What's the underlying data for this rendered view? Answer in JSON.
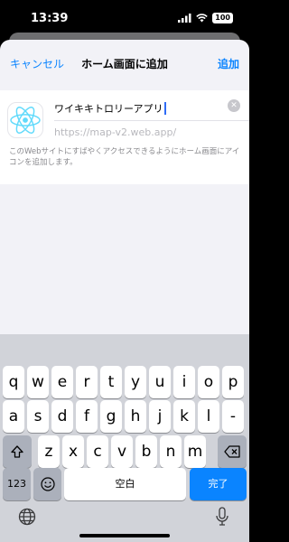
{
  "status": {
    "time": "13:39",
    "battery": "100"
  },
  "nav": {
    "cancel_label": "キャンセル",
    "title": "ホーム画面に追加",
    "add_label": "追加"
  },
  "form": {
    "name_value": "ワイキキトロリーアプリ",
    "url_value": "https://map-v2.web.app/",
    "hint_text": "このWebサイトにすばやくアクセスできるようにホーム画面にアイコンを追加します。"
  },
  "keyboard": {
    "row1": [
      "q",
      "w",
      "e",
      "r",
      "t",
      "y",
      "u",
      "i",
      "o",
      "p"
    ],
    "row2": [
      "a",
      "s",
      "d",
      "f",
      "g",
      "h",
      "j",
      "k",
      "l",
      "-"
    ],
    "row3": [
      "z",
      "x",
      "c",
      "v",
      "b",
      "n",
      "m"
    ],
    "numbers_label": "123",
    "space_label": "空白",
    "done_label": "完了"
  },
  "colors": {
    "accent": "#0a84ff",
    "icon_react": "#61dafb"
  },
  "icons": [
    "wifi-icon",
    "signal-icon",
    "battery-icon",
    "react-logo-icon",
    "clear-icon",
    "shift-icon",
    "delete-icon",
    "emoji-icon",
    "globe-icon",
    "microphone-icon"
  ]
}
